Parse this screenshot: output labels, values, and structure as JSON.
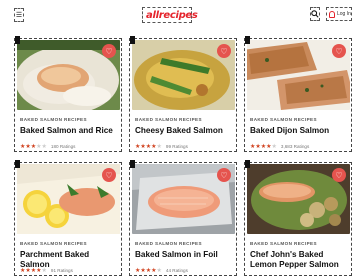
{
  "header": {
    "menu_icon": "menu-icon",
    "logo": "allrecipes",
    "search_icon": "search-icon",
    "login_label": "Log In"
  },
  "cards": [
    {
      "tag": "BAKED SALMON RECIPES",
      "title": "Baked Salmon and Rice",
      "stars": 3.5,
      "ratings": "180 Ratings"
    },
    {
      "tag": "BAKED SALMON RECIPES",
      "title": "Cheesy Baked Salmon",
      "stars": 4.5,
      "ratings": "99 Ratings"
    },
    {
      "tag": "BAKED SALMON RECIPES",
      "title": "Baked Dijon Salmon",
      "stars": 4.5,
      "ratings": "3,683 Ratings"
    },
    {
      "tag": "BAKED SALMON RECIPES",
      "title": "Parchment Baked Salmon",
      "stars": 4.5,
      "ratings": "91 Ratings"
    },
    {
      "tag": "BAKED SALMON RECIPES",
      "title": "Baked Salmon in Foil",
      "stars": 4.5,
      "ratings": "44 Ratings"
    },
    {
      "tag": "",
      "title": "Chef John's Baked Lemon Pepper Salmon",
      "stars": null,
      "ratings": ""
    }
  ],
  "colors": {
    "brand": "#e5232b",
    "heart": "#e5544e",
    "star": "#d0421f"
  }
}
